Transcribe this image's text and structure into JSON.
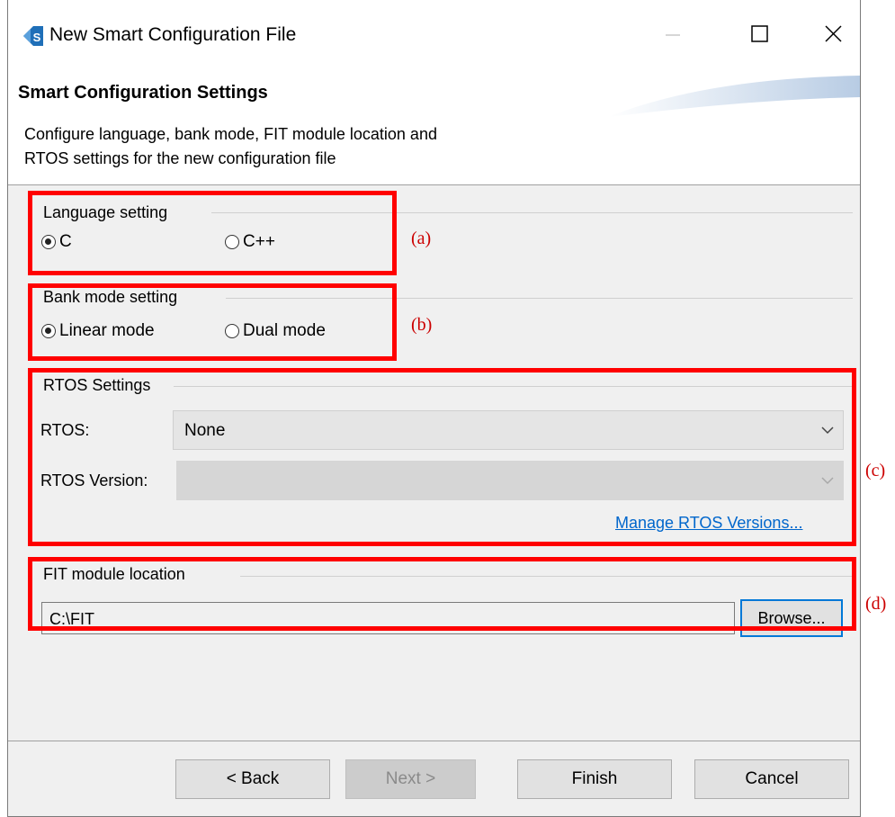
{
  "window": {
    "title": "New Smart Configuration File",
    "controls": [
      "minimize",
      "maximize",
      "close"
    ]
  },
  "banner": {
    "title": "Smart Configuration Settings",
    "description_line1": "Configure language, bank mode, FIT module location and",
    "description_line2": "RTOS settings for the new configuration file"
  },
  "language": {
    "title": "Language setting",
    "options": [
      {
        "label": "C",
        "selected": true
      },
      {
        "label": "C++",
        "selected": false
      }
    ]
  },
  "bank_mode": {
    "title": "Bank mode setting",
    "options": [
      {
        "label": "Linear mode",
        "selected": true
      },
      {
        "label": "Dual mode",
        "selected": false
      }
    ]
  },
  "rtos": {
    "title": "RTOS Settings",
    "rtos_label": "RTOS:",
    "rtos_value": "None",
    "version_label": "RTOS Version:",
    "version_value": "",
    "manage_link": "Manage RTOS Versions..."
  },
  "fit": {
    "title": "FIT module location",
    "path": "C:\\FIT",
    "browse_label": "Browse..."
  },
  "footer": {
    "back": "< Back",
    "next": "Next >",
    "finish": "Finish",
    "cancel": "Cancel"
  },
  "annotations": [
    "(a)",
    "(b)",
    "(c)",
    "(d)"
  ],
  "colors": {
    "annotation": "#ff0000",
    "link": "#0066cc",
    "focus": "#0078d7"
  }
}
